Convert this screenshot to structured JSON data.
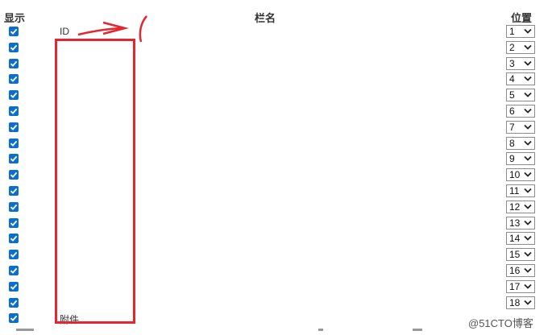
{
  "header": {
    "show": "显示",
    "name": "栏名",
    "position": "位置"
  },
  "rows": [
    {
      "label": "ID",
      "position": "1"
    },
    {
      "label": "",
      "position": "2"
    },
    {
      "label": "",
      "position": "3"
    },
    {
      "label": "",
      "position": "4"
    },
    {
      "label": "",
      "position": "5"
    },
    {
      "label": "",
      "position": "6"
    },
    {
      "label": "",
      "position": "7"
    },
    {
      "label": "",
      "position": "8"
    },
    {
      "label": "",
      "position": "9"
    },
    {
      "label": "",
      "position": "10"
    },
    {
      "label": "",
      "position": "11"
    },
    {
      "label": "",
      "position": "12"
    },
    {
      "label": "",
      "position": "13"
    },
    {
      "label": "",
      "position": "14"
    },
    {
      "label": "",
      "position": "15"
    },
    {
      "label": "",
      "position": "16"
    },
    {
      "label": "",
      "position": "17"
    },
    {
      "label": "",
      "position": "18"
    },
    {
      "label": "附件",
      "position": ""
    }
  ],
  "watermark": "@51CTO博客",
  "colors": {
    "accent": "#0a6ed1",
    "annotation": "#e3262f"
  }
}
